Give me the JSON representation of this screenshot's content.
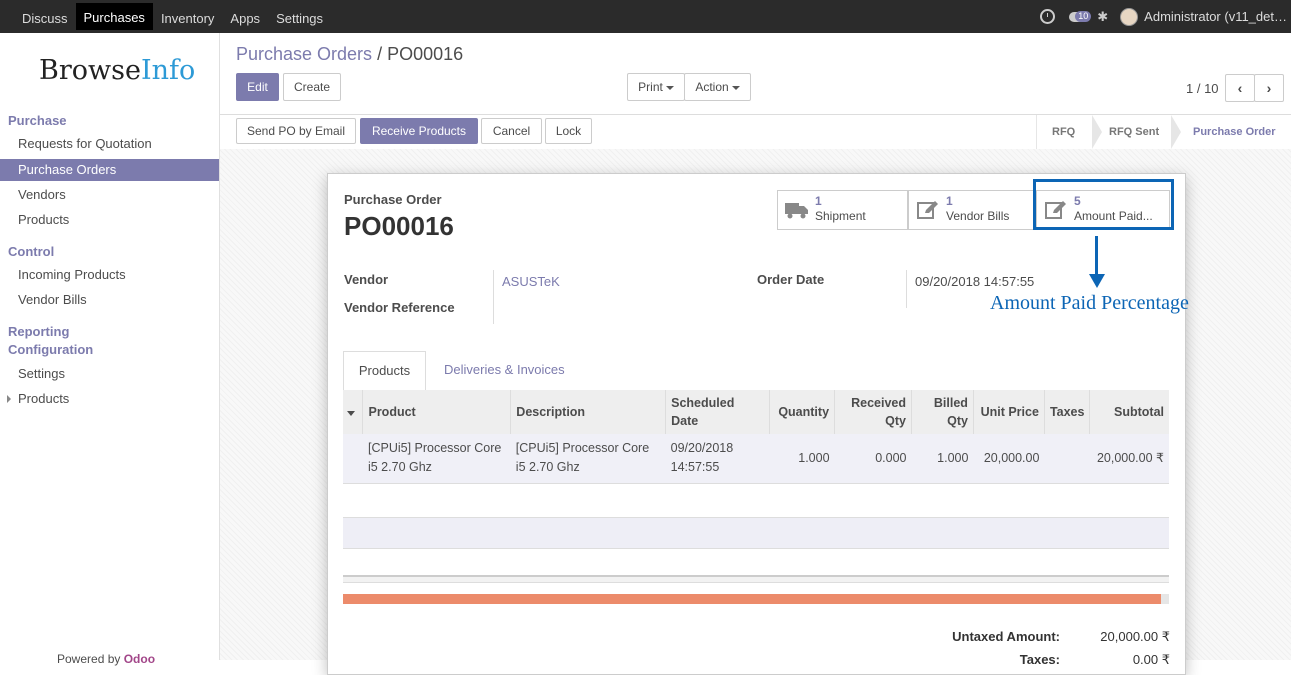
{
  "topbar": {
    "menu": [
      "Discuss",
      "Purchases",
      "Inventory",
      "Apps",
      "Settings"
    ],
    "active_menu": "Purchases",
    "message_count": "10",
    "user": "Administrator (v11_det…"
  },
  "sidebar": {
    "logo_part1": "Browse",
    "logo_part2": "Info",
    "sections": [
      {
        "title": "Purchase",
        "items": [
          "Requests for Quotation",
          "Purchase Orders",
          "Vendors",
          "Products"
        ]
      },
      {
        "title": "Control",
        "items": [
          "Incoming Products",
          "Vendor Bills"
        ]
      },
      {
        "title": "Reporting",
        "items": []
      },
      {
        "title": "Configuration",
        "items": [
          "Settings",
          "Products"
        ]
      }
    ],
    "active_item": "Purchase Orders",
    "powered_prefix": "Powered by ",
    "powered_brand": "Odoo"
  },
  "breadcrumb": {
    "parent": "Purchase Orders",
    "separator": "/",
    "current": "PO00016"
  },
  "toolbar": {
    "edit": "Edit",
    "create": "Create",
    "print": "Print",
    "action": "Action"
  },
  "pager": {
    "value": "1 / 10"
  },
  "statusbar": {
    "buttons": [
      "Send PO by Email",
      "Receive Products",
      "Cancel",
      "Lock"
    ],
    "stages": [
      "RFQ",
      "RFQ Sent",
      "Purchase Order"
    ],
    "active_stage": "Purchase Order"
  },
  "form": {
    "doc_type": "Purchase Order",
    "name": "PO00016",
    "smart_buttons": [
      {
        "count": "1",
        "label": "Shipment",
        "icon": "truck-icon"
      },
      {
        "count": "1",
        "label": "Vendor Bills",
        "icon": "edit-icon"
      },
      {
        "count": "5",
        "label": "Amount Paid...",
        "icon": "edit-icon"
      }
    ],
    "vendor_label": "Vendor",
    "vendor_value": "ASUSTeK",
    "vendor_ref_label": "Vendor Reference",
    "order_date_label": "Order Date",
    "order_date_value": "09/20/2018 14:57:55",
    "tabs": [
      "Products",
      "Deliveries & Invoices"
    ],
    "columns": [
      "Product",
      "Description",
      "Scheduled Date",
      "Quantity",
      "Received Qty",
      "Billed Qty",
      "Unit Price",
      "Taxes",
      "Subtotal"
    ],
    "lines": [
      {
        "product": "[CPUi5] Processor Core i5 2.70 Ghz",
        "description": "[CPUi5] Processor Core i5 2.70 Ghz",
        "scheduled_date": "09/20/2018 14:57:55",
        "quantity": "1.000",
        "received_qty": "0.000",
        "billed_qty": "1.000",
        "unit_price": "20,000.00",
        "taxes": "",
        "subtotal": "20,000.00 ₹"
      }
    ],
    "amount_paid_fraction": 0.99,
    "totals": [
      {
        "label": "Untaxed Amount:",
        "value": "20,000.00 ₹"
      },
      {
        "label": "Taxes:",
        "value": "0.00 ₹"
      }
    ]
  },
  "annotation": {
    "text": "Amount Paid Percentage",
    "color": "#0c65b5"
  },
  "colors": {
    "accent": "#7c7bad",
    "topbar": "#2b2b2b",
    "progress": "#ec8b6b"
  }
}
